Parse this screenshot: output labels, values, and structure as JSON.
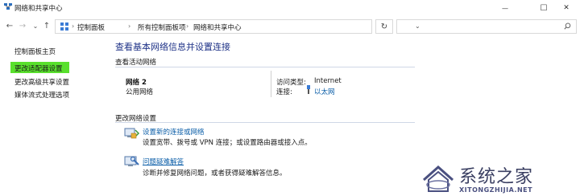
{
  "window": {
    "title": "网络和共享中心",
    "controls": {
      "minimize": "—",
      "maximize": "☐",
      "close": "✕"
    }
  },
  "navigation": {
    "back": "←",
    "forward": "→",
    "recent": "⌄",
    "up": "↑",
    "breadcrumb": [
      "控制面板",
      "所有控制面板项",
      "网络和共享中心"
    ],
    "separator": "›",
    "dropdown": "⌄",
    "refresh": "↻",
    "search": {
      "placeholder": "",
      "icon": "search-icon"
    }
  },
  "sidebar": {
    "items": [
      {
        "label": "控制面板主页"
      },
      {
        "label": "更改适配器设置",
        "highlighted": true
      },
      {
        "label": "更改高级共享设置"
      },
      {
        "label": "媒体流式处理选项"
      }
    ],
    "highlight_color": "#59e02d"
  },
  "main": {
    "title": "查看基本网络信息并设置连接",
    "active_networks": {
      "heading": "查看活动网络",
      "network_name": "网络 2",
      "network_type": "公用网络",
      "access_type_label": "访问类型:",
      "access_type_value": "Internet",
      "connection_label": "连接:",
      "connection_value": "以太网"
    },
    "change_settings": {
      "heading": "更改网络设置",
      "tasks": [
        {
          "link": "设置新的连接或网络",
          "description": "设置宽带、拨号或 VPN 连接；或设置路由器或接入点。"
        },
        {
          "link": "问题疑难解答",
          "description": "诊断并修复网络问题，或者获得疑难解答信息。"
        }
      ]
    }
  },
  "watermark": {
    "title": "系统之家",
    "url": "XITONGZHIJIA.NET"
  },
  "colors": {
    "link": "#0b5ea8",
    "title": "#1e3287",
    "rule": "#cfd7e6"
  }
}
